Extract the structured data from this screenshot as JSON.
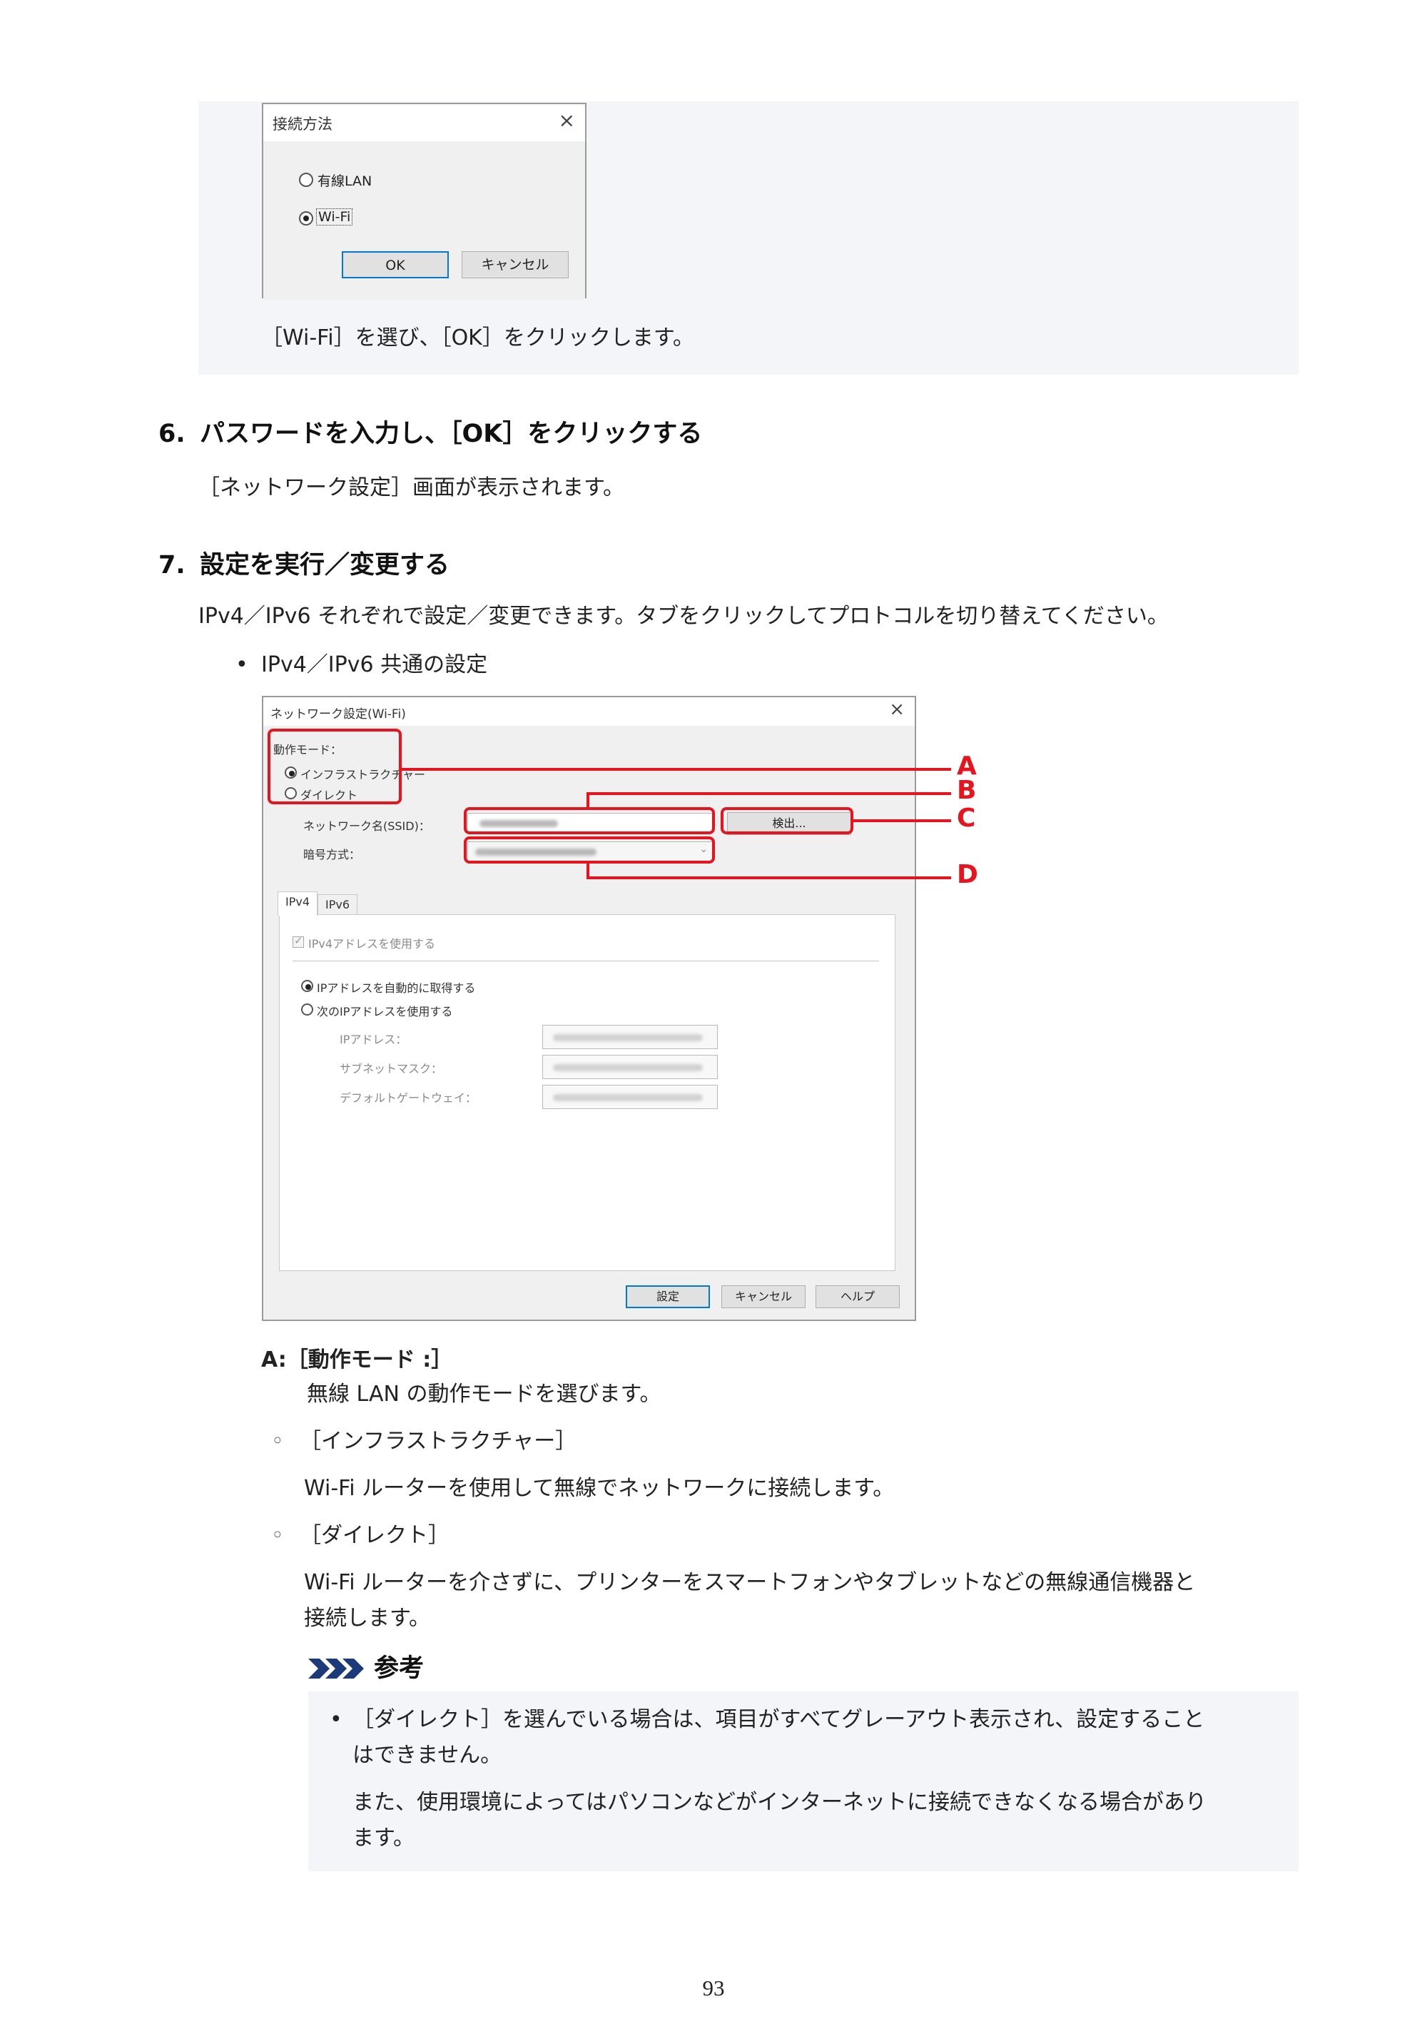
{
  "dialog_connection": {
    "title": "接続方法",
    "close": "×",
    "option_wired": "有線LAN",
    "option_wifi": "Wi-Fi",
    "ok": "OK",
    "cancel": "キャンセル"
  },
  "step5_caption": "［Wi-Fi］を選び、［OK］をクリックします。",
  "step6": {
    "number": "6.",
    "heading": "パスワードを入力し、［OK］をクリックする",
    "body": "［ネットワーク設定］画面が表示されます。"
  },
  "step7": {
    "number": "7.",
    "heading": "設定を実行／変更する",
    "body": "IPv4／IPv6 それぞれで設定／変更できます。タブをクリックしてプロトコルを切り替えてください。",
    "bullet": "IPv4／IPv6 共通の設定"
  },
  "dialog_network": {
    "title": "ネットワーク設定(Wi-Fi)",
    "close": "×",
    "mode_label": "動作モード：",
    "mode_infra": "インフラストラクチャー",
    "mode_direct": "ダイレクト",
    "ssid_label": "ネットワーク名(SSID)：",
    "detect_button": "検出...",
    "encryption_label": "暗号方式：",
    "tab_ipv4": "IPv4",
    "tab_ipv6": "IPv6",
    "use_ipv4": "IPv4アドレスを使用する",
    "auto_ip": "IPアドレスを自動的に取得する",
    "manual_ip": "次のIPアドレスを使用する",
    "ip_address": "IPアドレス：",
    "subnet_mask": "サブネットマスク：",
    "default_gateway": "デフォルトゲートウェイ：",
    "set_button": "設定",
    "cancel_button": "キャンセル",
    "help_button": "ヘルプ"
  },
  "callouts": {
    "a": "A",
    "b": "B",
    "c": "C",
    "d": "D"
  },
  "item_a": {
    "label": "A:［動作モード :］",
    "description": "無線 LAN の動作モードを選びます。",
    "sub1_title": "［インフラストラクチャー］",
    "sub1_body": "Wi-Fi ルーターを使用して無線でネットワークに接続します。",
    "sub2_title": "［ダイレクト］",
    "sub2_body_line1": "Wi-Fi ルーターを介さずに、プリンターをスマートフォンやタブレットなどの無線通信機器と",
    "sub2_body_line2": "接続します。"
  },
  "note": {
    "heading": "参考",
    "line1": "［ダイレクト］を選んでいる場合は、項目がすべてグレーアウト表示され、設定すること",
    "line2": "はできません。",
    "line3": "また、使用環境によってはパソコンなどがインターネットに接続できなくなる場合があり",
    "line4": "ます。"
  },
  "page_number": "93",
  "colors": {
    "callout_red": "#e8141d",
    "panel_gray": "#f4f5f8",
    "focus_blue": "#0078d7"
  }
}
